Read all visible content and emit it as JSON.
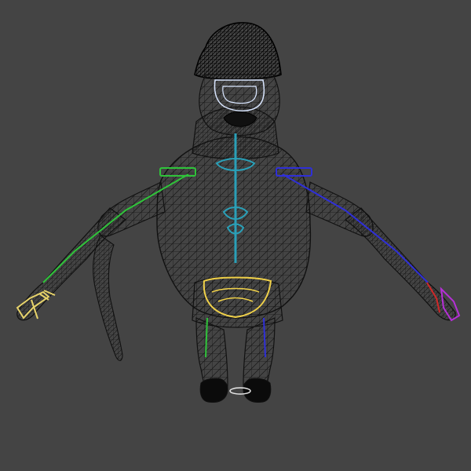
{
  "viewport": {
    "background": "#444444"
  },
  "colors": {
    "mesh": "#111111",
    "helmet": "#0a0a0a",
    "face_rig": "#d9e6ff",
    "spine_rig": "#2aa0b8",
    "left_arm_rig": "#2fc43a",
    "right_arm_rig": "#2f2fd8",
    "left_hand_rig": "#e7d36a",
    "right_hand_rig_red": "#d02828",
    "right_hand_rig_magenta": "#b62fd8",
    "pelvis_rig": "#f1d24a",
    "left_leg_rig": "#2fc43a",
    "right_leg_rig": "#2f2fd8",
    "ground_marker": "#e8e8e8"
  },
  "icons": {
    "viewport": "wireframe-character-viewport-icon"
  }
}
